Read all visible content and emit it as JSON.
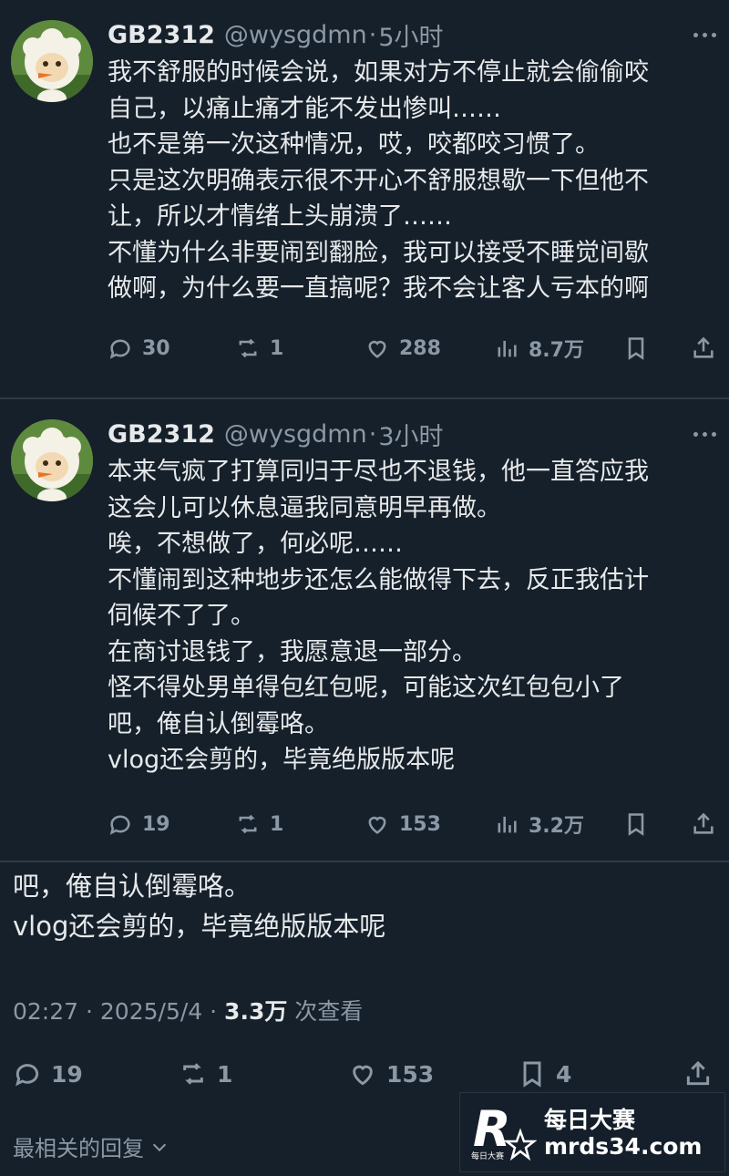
{
  "tweets": [
    {
      "author_name": "GB2312",
      "handle": "@wysgdmn",
      "separator": "·",
      "time": "5小时",
      "lines": [
        "我不舒服的时候会说，如果对方不停止就会偷偷咬",
        "自己，以痛止痛才能不发出惨叫……",
        "也不是第一次这种情况，哎，咬都咬习惯了。",
        "只是这次明确表示很不开心不舒服想歇一下但他不",
        "让，所以才情绪上头崩溃了……",
        "不懂为什么非要闹到翻脸，我可以接受不睡觉间歇",
        "做啊，为什么要一直搞呢？我不会让客人亏本的啊"
      ],
      "replies": "30",
      "retweets": "1",
      "likes": "288",
      "views": "8.7万"
    },
    {
      "author_name": "GB2312",
      "handle": "@wysgdmn",
      "separator": "·",
      "time": "3小时",
      "lines": [
        "本来气疯了打算同归于尽也不退钱，他一直答应我",
        "这会儿可以休息逼我同意明早再做。",
        "唉，不想做了，何必呢……",
        "不懂闹到这种地步还怎么能做得下去，反正我估计",
        "伺候不了了。",
        "在商讨退钱了，我愿意退一部分。",
        "怪不得处男单得包红包呢，可能这次红包包小了",
        "吧，俺自认倒霉咯。",
        "vlog还会剪的，毕竟绝版版本呢"
      ],
      "replies": "19",
      "retweets": "1",
      "likes": "153",
      "views": "3.2万"
    }
  ],
  "detail": {
    "lines": [
      "吧，俺自认倒霉咯。",
      "vlog还会剪的，毕竟绝版版本呢"
    ],
    "time": "02:27",
    "separator": "·",
    "date": "2025/5/4",
    "views_count": "3.3万",
    "views_label": "次查看",
    "replies": "19",
    "retweets": "1",
    "likes": "153",
    "bookmarks": "4"
  },
  "replies_sort": {
    "label": "最相关的回复"
  },
  "watermark": {
    "brand_cn": "每日大赛",
    "domain": "mrds34.com",
    "logo_letter": "R",
    "logo_small": "每日大赛"
  },
  "colors": {
    "background": "#15202b",
    "text": "#e7e9ea",
    "muted": "#8b98a5",
    "divider": "#2f3b47"
  },
  "icons": [
    "reply-icon",
    "retweet-icon",
    "like-icon",
    "views-icon",
    "bookmark-icon",
    "share-icon",
    "more-icon",
    "chevron-down-icon"
  ]
}
